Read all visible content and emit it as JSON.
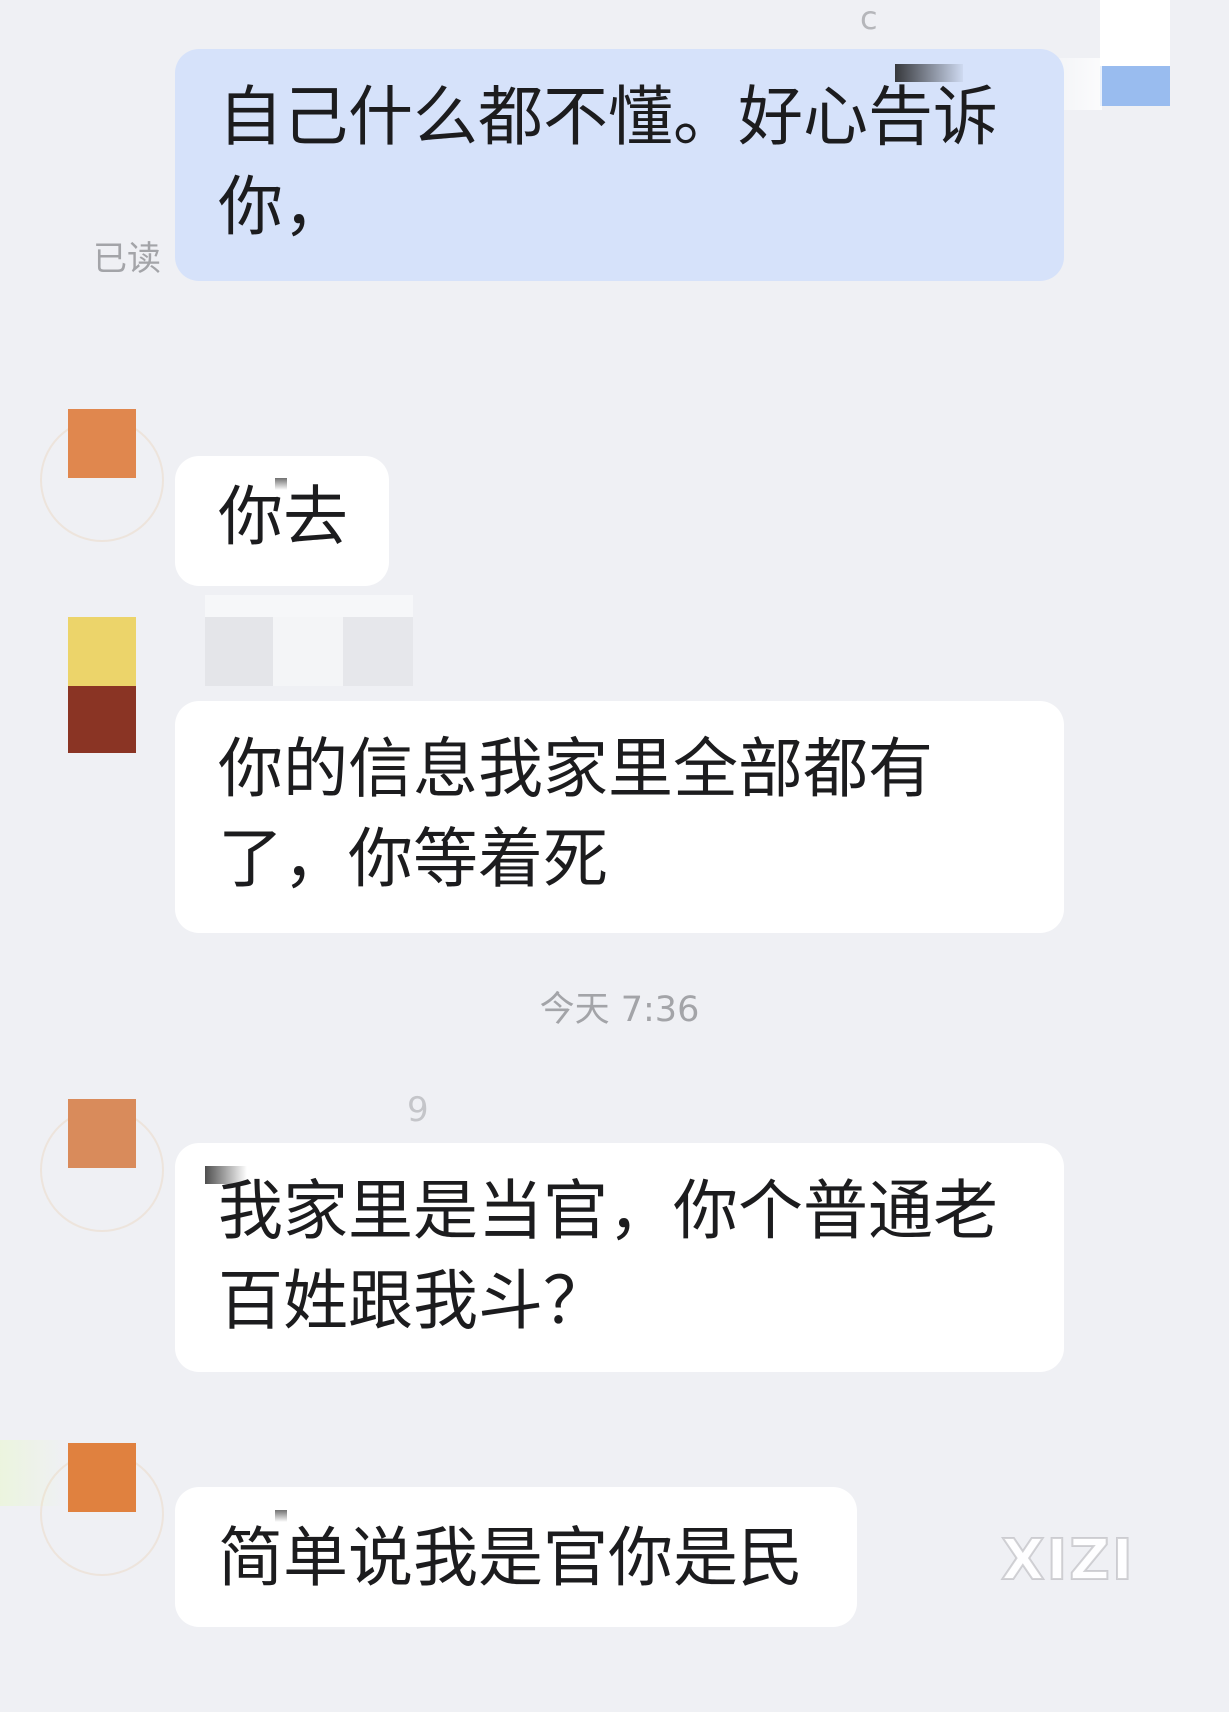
{
  "theme": {
    "page_background": "#eff0f4",
    "outgoing_bubble": "#d6e2fa",
    "incoming_bubble": "#ffffff",
    "message_text": "#1c1c1e",
    "meta_text": "#a3a4a8"
  },
  "top_name_fragment": "c",
  "top_right_avatar_colors": [
    "#ffffff",
    "#8fb6ee"
  ],
  "outgoing_message": {
    "lines": [
      "自己什么都不懂。好心告诉",
      "你，"
    ],
    "read_status": "已读"
  },
  "incoming_messages": [
    {
      "avatar_colors": [
        "#e0874e"
      ],
      "lines": [
        "你去"
      ]
    },
    {
      "avatar_colors": [
        "#ecd46a",
        "#8a3424"
      ],
      "lines": [
        "你的信息我家里全部都有",
        "了，你等着死"
      ]
    },
    {
      "sender_name_fragment": "9",
      "avatar_colors": [
        "#d98b5b"
      ],
      "lines": [
        "我家里是当官，你个普通老",
        "百姓跟我斗？"
      ]
    },
    {
      "avatar_colors": [
        "#e0813f"
      ],
      "lines": [
        "简单说我是官你是民"
      ]
    }
  ],
  "timestamp": "今天 7:36",
  "watermark": "XIZI"
}
